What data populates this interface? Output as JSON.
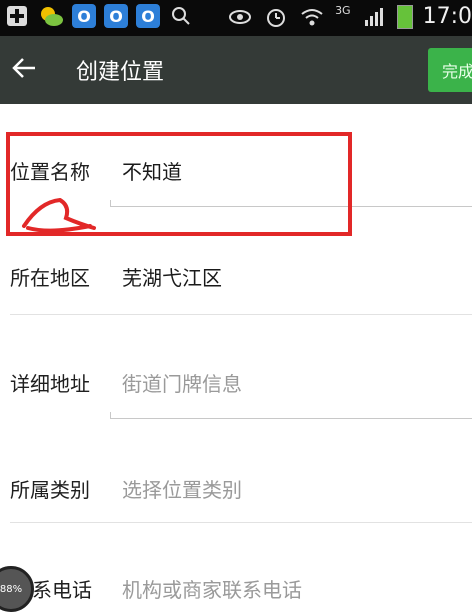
{
  "status_bar": {
    "time": "17:0",
    "network": "3G",
    "icons": [
      "plus-square-icon",
      "weather-icon",
      "app-icon",
      "app-icon",
      "app-icon",
      "search-icon",
      "eye-icon",
      "alarm-icon",
      "wifi-icon",
      "signal-icon",
      "battery-icon"
    ]
  },
  "toolbar": {
    "title": "创建位置",
    "done_label": "完成"
  },
  "form": {
    "name": {
      "label": "位置名称",
      "value": "不知道"
    },
    "region": {
      "label": "所在地区",
      "value": "芜湖弋江区"
    },
    "address": {
      "label": "详细地址",
      "placeholder": "街道门牌信息"
    },
    "category": {
      "label": "所属类别",
      "placeholder": "选择位置类别"
    },
    "phone": {
      "label": "系电话",
      "placeholder": "机构或商家联系电话"
    }
  },
  "floating_badge": {
    "text": "88%"
  },
  "colors": {
    "toolbar": "#343a37",
    "accent": "#3bb34a",
    "annotation": "#e22828"
  }
}
